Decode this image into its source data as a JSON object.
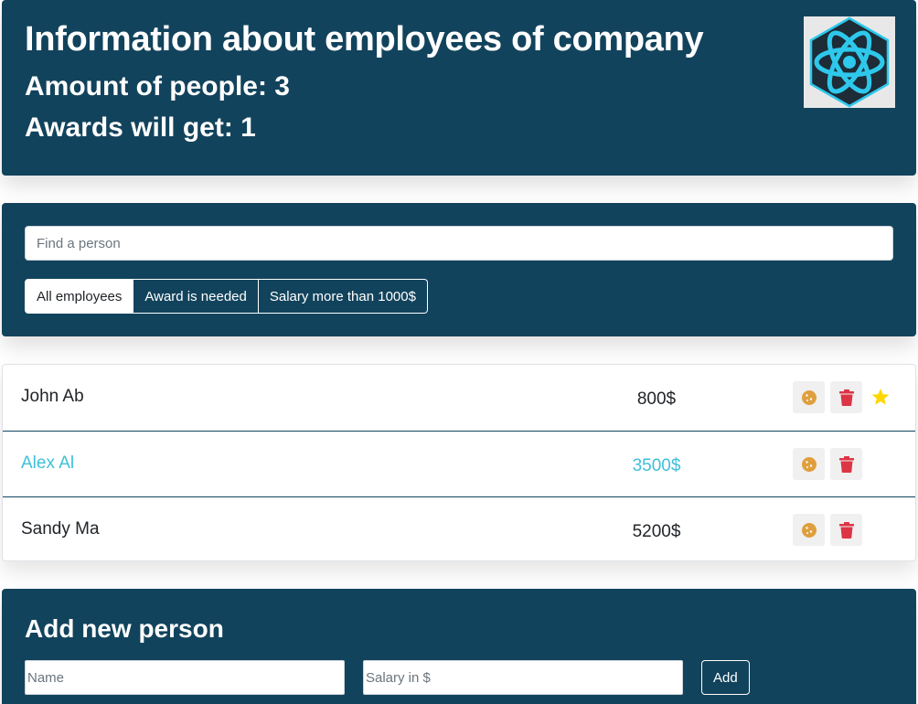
{
  "header": {
    "title": "Information about employees of company",
    "amount_label": "Amount of people: 3",
    "awards_label": "Awards will get: 1",
    "logo": "react-logo"
  },
  "search": {
    "placeholder": "Find a person",
    "value": ""
  },
  "filters": [
    {
      "label": "All employees",
      "active": true
    },
    {
      "label": "Award is needed",
      "active": false
    },
    {
      "label": "Salary more than 1000$",
      "active": false
    }
  ],
  "employees": [
    {
      "name": "John Ab",
      "salary": "800$",
      "increase": false,
      "rise": true
    },
    {
      "name": "Alex Al",
      "salary": "3500$",
      "increase": true,
      "rise": false
    },
    {
      "name": "Sandy Ma",
      "salary": "5200$",
      "increase": false,
      "rise": false
    }
  ],
  "row_actions": {
    "cookie_icon": "cookie-icon",
    "trash_icon": "trash-icon",
    "star_icon": "star-icon"
  },
  "add_form": {
    "title": "Add new person",
    "name_placeholder": "Name",
    "salary_placeholder": "Salary in $",
    "submit_label": "Add"
  },
  "colors": {
    "panel_bg": "#12435c",
    "highlight_text": "#3fc0d9",
    "cookie": "#e09f3e",
    "trash": "#dc3545",
    "star": "#ffd700"
  }
}
